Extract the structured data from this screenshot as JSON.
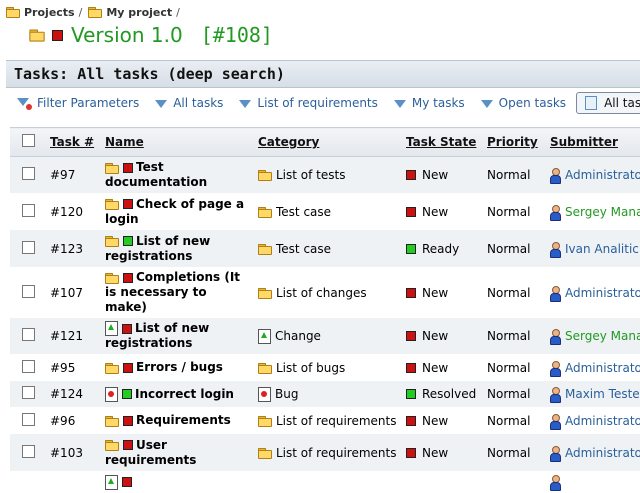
{
  "breadcrumbs": [
    {
      "label": "Projects",
      "sep": "/"
    },
    {
      "label": "My project",
      "sep": "/"
    }
  ],
  "page": {
    "title": "Version 1.0",
    "number": "[#108]"
  },
  "section": {
    "title": "Tasks: All tasks (deep search)"
  },
  "filters": [
    {
      "label": "Filter Parameters"
    },
    {
      "label": "All tasks"
    },
    {
      "label": "List of requirements"
    },
    {
      "label": "My tasks"
    },
    {
      "label": "Open tasks"
    },
    {
      "label": "All tasks ("
    }
  ],
  "table": {
    "headers": {
      "task_num": "Task #",
      "name": "Name",
      "category": "Category",
      "state": "Task State",
      "priority": "Priority",
      "submitter": "Submitter"
    },
    "rows": [
      {
        "num": "#97",
        "name": "Test documentation",
        "name_icon": "folder",
        "status_color": "red",
        "category": "List of tests",
        "cat_icon": "folder",
        "state": "New",
        "state_color": "red",
        "priority": "Normal",
        "submitter": "Administrator",
        "submitter_color": "blue",
        "height": 36
      },
      {
        "num": "#120",
        "name": "Check of page a login",
        "name_icon": "folder",
        "status_color": "red",
        "category": "Test case",
        "cat_icon": "folder",
        "state": "New",
        "state_color": "red",
        "priority": "Normal",
        "submitter": "Sergey Manager",
        "submitter_color": "green",
        "height": 37
      },
      {
        "num": "#123",
        "name": "List of new registrations",
        "name_icon": "folder",
        "status_color": "green",
        "category": "Test case",
        "cat_icon": "folder",
        "state": "Ready",
        "state_color": "green",
        "priority": "Normal",
        "submitter": "Ivan Analitic",
        "submitter_color": "blue",
        "height": 37
      },
      {
        "num": "#107",
        "name": "Completions (It is necessary to make)",
        "name_icon": "folder",
        "status_color": "red",
        "category": "List of changes",
        "cat_icon": "folder",
        "state": "New",
        "state_color": "red",
        "priority": "Normal",
        "submitter": "Administrator",
        "submitter_color": "blue",
        "height": 51
      },
      {
        "num": "#121",
        "name": "List of new registrations",
        "name_icon": "change",
        "status_color": "red",
        "category": "Change",
        "cat_icon": "change",
        "state": "New",
        "state_color": "red",
        "priority": "Normal",
        "submitter": "Sergey Manager",
        "submitter_color": "green",
        "height": 36
      },
      {
        "num": "#95",
        "name": "Errors / bugs",
        "name_icon": "folder",
        "status_color": "red",
        "category": "List of bugs",
        "cat_icon": "folder",
        "state": "New",
        "state_color": "red",
        "priority": "Normal",
        "submitter": "Administrator",
        "submitter_color": "blue",
        "height": 27
      },
      {
        "num": "#124",
        "name": "Incorrect login",
        "name_icon": "bug",
        "status_color": "green",
        "category": "Bug",
        "cat_icon": "bug",
        "state": "Resolved",
        "state_color": "green",
        "priority": "Normal",
        "submitter": "Maxim Tester",
        "submitter_color": "blue",
        "height": 26
      },
      {
        "num": "#96",
        "name": "Requirements",
        "name_icon": "folder",
        "status_color": "red",
        "category": "List of requirements",
        "cat_icon": "folder",
        "state": "New",
        "state_color": "red",
        "priority": "Normal",
        "submitter": "Administrator",
        "submitter_color": "blue",
        "height": 27
      },
      {
        "num": "#103",
        "name": "User requirements",
        "name_icon": "folder",
        "status_color": "red",
        "category": "List of requirements",
        "cat_icon": "folder",
        "state": "New",
        "state_color": "red",
        "priority": "Normal",
        "submitter": "Administrator",
        "submitter_color": "blue",
        "height": 37
      },
      {
        "num": "",
        "name": "",
        "name_icon": "change",
        "status_color": "red",
        "category": "",
        "cat_icon": "",
        "state": "",
        "state_color": "",
        "priority": "",
        "submitter": "",
        "submitter_color": "blue",
        "height": 22
      }
    ]
  },
  "colors": {
    "title": "#229922",
    "link": "#2a5f9a",
    "status_red": "#cc1111",
    "status_green": "#22cc22"
  },
  "icons": {
    "folder": "folder-icon",
    "status": "status-square-icon",
    "filter": "funnel-icon",
    "user": "user-icon",
    "bug": "bug-icon",
    "change": "change-icon"
  }
}
